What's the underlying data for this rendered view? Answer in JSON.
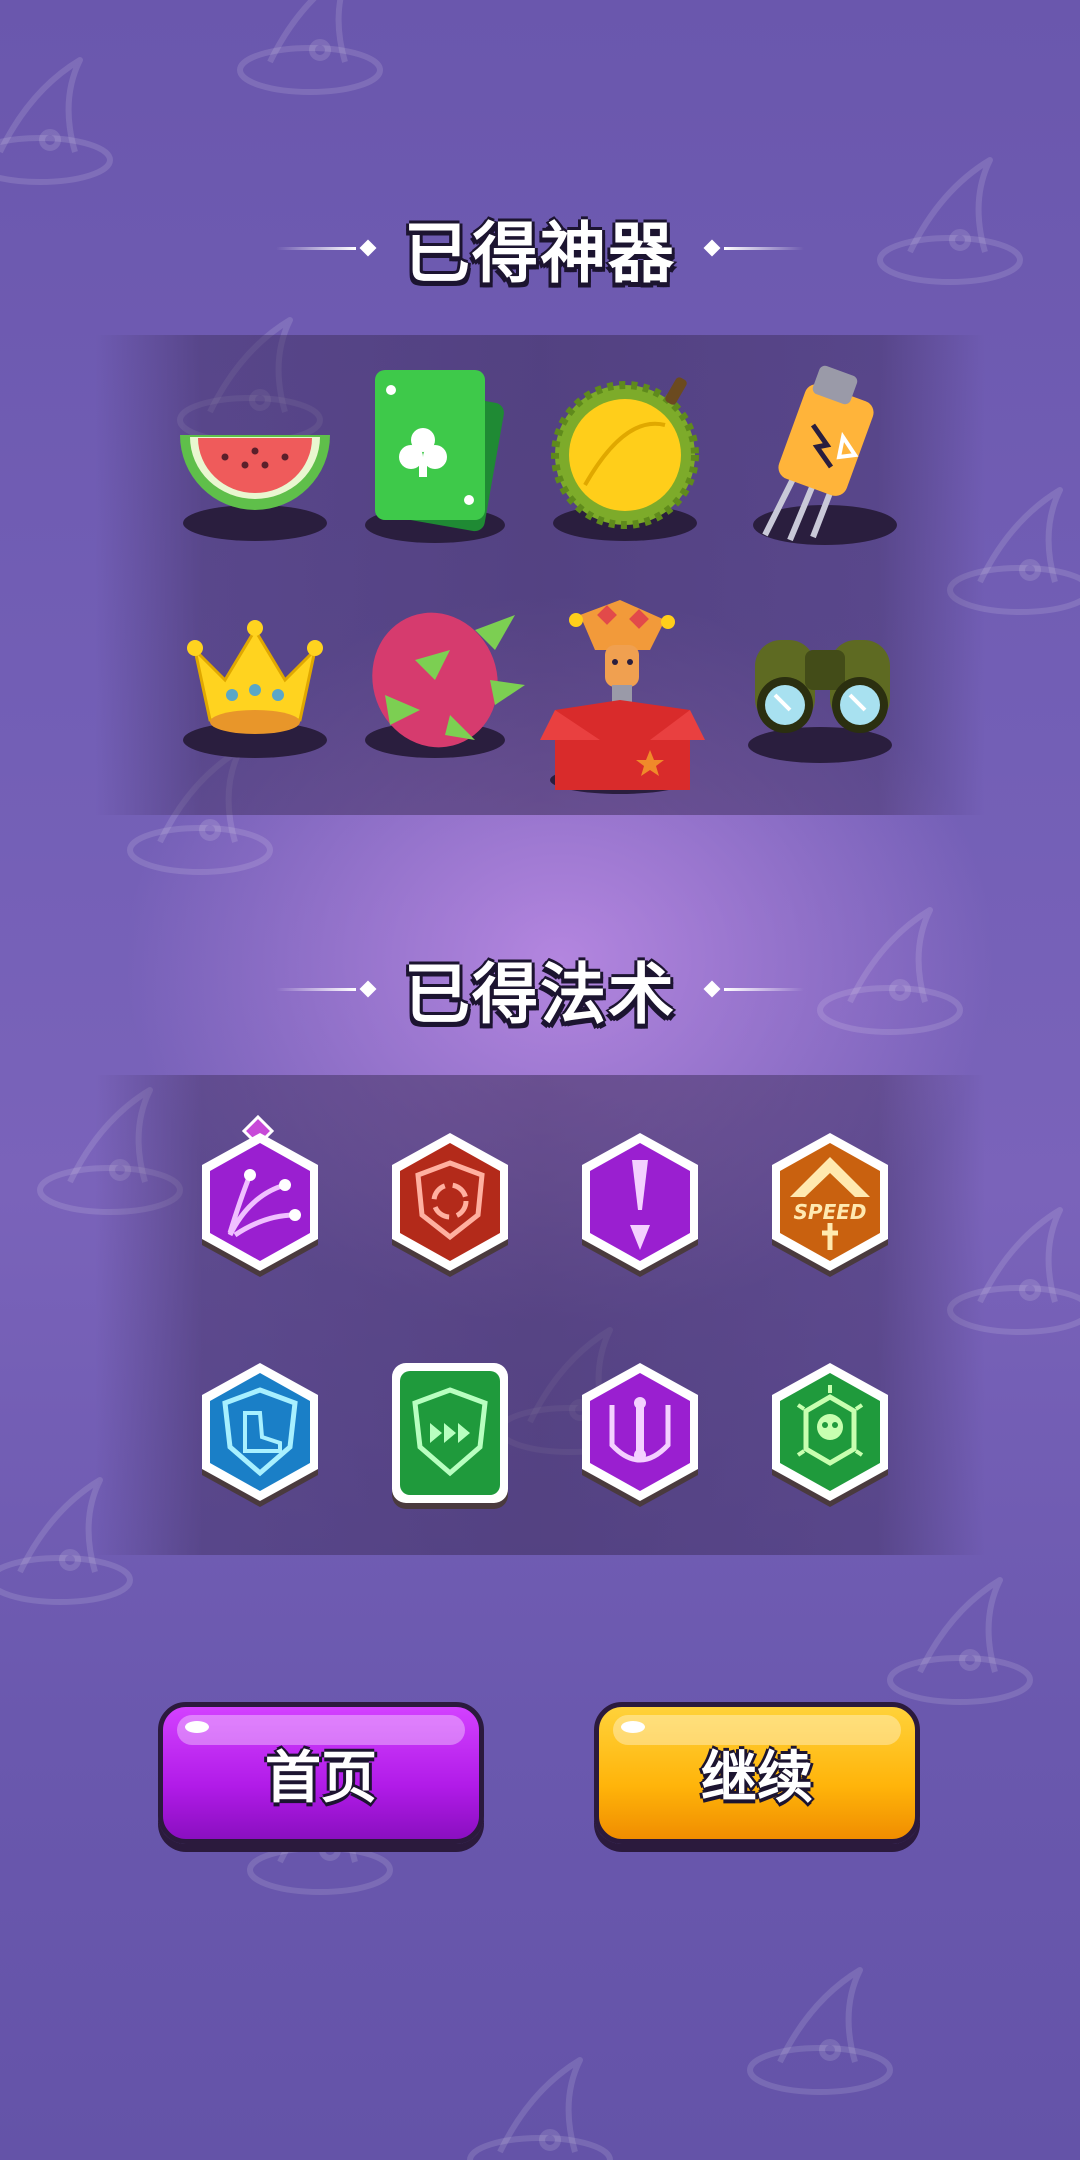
{
  "artifacts_section": {
    "title": "已得神器",
    "items": [
      "watermelon-icon",
      "playing-card-icon",
      "durian-icon",
      "battery-icon",
      "crown-icon",
      "dragon-fruit-icon",
      "jack-in-the-box-icon",
      "binoculars-icon"
    ]
  },
  "spells_section": {
    "title": "已得法术",
    "items": [
      "multi-shot-spell-icon",
      "rotation-shield-spell-icon",
      "piercing-arrow-spell-icon",
      "speed-up-spell-icon",
      "boot-shield-spell-icon",
      "fast-forward-shield-spell-icon",
      "bone-shield-spell-icon",
      "poison-skull-spell-icon"
    ],
    "speed_badge_text": "SPEED"
  },
  "buttons": {
    "home_label": "首页",
    "continue_label": "继续"
  },
  "colors": {
    "background": "#6a57ad",
    "home_button": "#b11be8",
    "continue_button": "#ffb40a"
  }
}
